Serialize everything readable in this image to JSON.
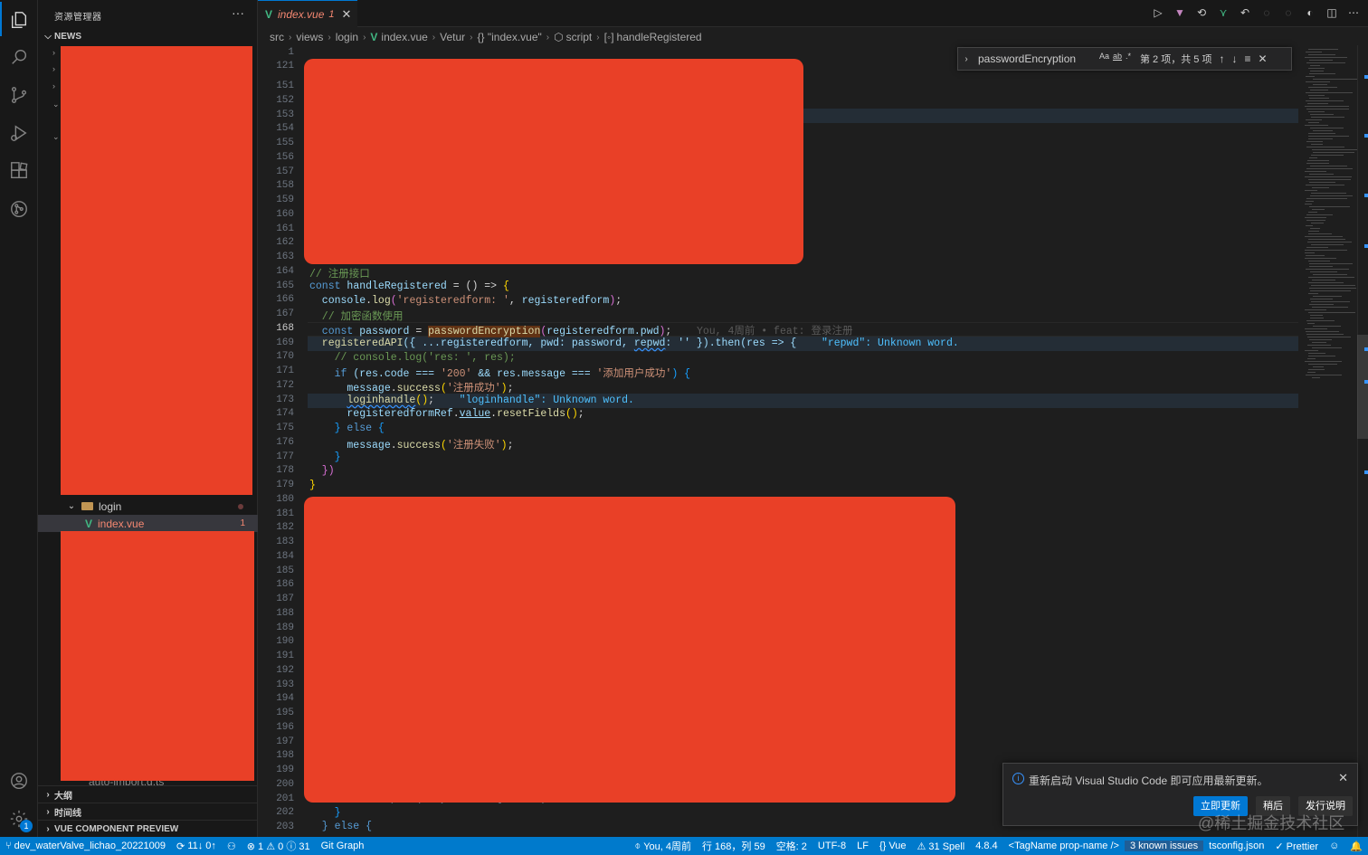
{
  "sidebar": {
    "title": "资源管理器",
    "more": "···",
    "section_news": "NEWS",
    "folder_login": "login",
    "file_index": "index.vue",
    "file_index_errors": "1",
    "partial_item": "auto-import.d.ts",
    "section_outline": "大纲",
    "section_timeline": "时间线",
    "section_vue_preview": "VUE COMPONENT PREVIEW"
  },
  "tab": {
    "label": "index.vue",
    "errors": "1",
    "close": "✕"
  },
  "breadcrumb": [
    "src",
    "views",
    "login",
    "index.vue",
    "Vetur",
    "{} \"index.vue\"",
    "script",
    "handleRegistered"
  ],
  "find": {
    "query": "passwordEncryption",
    "opt_case": "Aa",
    "opt_word": "ab",
    "opt_regex": ".*",
    "count": "第 2 项，共 5 项",
    "prev": "↑",
    "next": "↓",
    "selection": "≡",
    "close": "✕"
  },
  "editor": {
    "line_numbers_top": [
      "1",
      "121",
      "151",
      "152",
      "153",
      "154",
      "155",
      "156",
      "157",
      "158",
      "159",
      "160",
      "161",
      "162",
      "163",
      "164",
      "165",
      "166",
      "167",
      "168",
      "169",
      "170",
      "171",
      "172",
      "173",
      "174",
      "175",
      "176",
      "177",
      "178",
      "179",
      "180",
      "181",
      "182",
      "183",
      "184",
      "185",
      "186",
      "187",
      "188",
      "189",
      "190",
      "191",
      "192",
      "193",
      "194",
      "195",
      "196",
      "197",
      "198",
      "199",
      "200",
      "201",
      "202",
      "203"
    ],
    "current_line": "168",
    "code": {
      "l164": "// 注册接口",
      "l165_kw": "const",
      "l165_name": " handleRegistered ",
      "l165_rest": "= () => ",
      "l165_brace": "{",
      "l166_obj": "  console",
      "l166_fn": "log",
      "l166_str": "'registeredform: '",
      "l166_arg": "registeredform",
      "l167": "  // 加密函数使用",
      "l168_kw": "  const",
      "l168_var": " password ",
      "l168_fn": "passwordEncryption",
      "l168_arg": "registeredform.pwd",
      "l168_blame": "You, 4周前 • feat: 登录注册",
      "l169_fn": "  registeredAPI",
      "l169_body": "({ ...registeredform, pwd: password, ",
      "l169_wavy": "repwd",
      "l169_tail": ": '' }).then(res => {",
      "l169_diag": "\"repwd\": Unknown word.",
      "l170": "    // console.log('res: ', res);",
      "l171_kw": "    if",
      "l171_body": " (res.code === ",
      "l171_str1": "'200'",
      "l171_mid": " && res.message === ",
      "l171_str2": "'添加用户成功'",
      "l171_end": ") {",
      "l172_obj": "      message",
      "l172_fn": "success",
      "l172_str": "'注册成功'",
      "l173_fn": "loginhandle",
      "l173_diag": "\"loginhandle\": Unknown word.",
      "l174_obj": "      registeredformRef",
      "l174_val": "value",
      "l174_fn": "resetFields",
      "l175_kw": "else",
      "l176_obj": "      message",
      "l176_fn": "success",
      "l176_str": "'注册失败'",
      "l177": "    }",
      "l178": "  })",
      "l179": "}",
      "l201": "      router.push('/systemManagement');",
      "l202": "    }",
      "l203": "  } else {"
    }
  },
  "notification": {
    "message": "重新启动 Visual Studio Code 即可应用最新更新。",
    "btn_update": "立即更新",
    "btn_later": "稍后",
    "btn_notes": "发行说明",
    "close": "✕"
  },
  "status": {
    "branch": "dev_waterValve_lichao_20221009",
    "sync": "11↓ 0↑",
    "problems": "⊗ 1 ⚠ 0 ⓘ 31",
    "git_graph": "Git Graph",
    "blame": "You, 4周前",
    "position": "行 168，列 59",
    "spaces": "空格: 2",
    "encoding": "UTF-8",
    "eol": "LF",
    "language": "Vue",
    "spell": "⚠ 31 Spell",
    "version": "4.8.4",
    "tagname": "<TagName prop-name />",
    "issues": "3 known issues",
    "tsconfig": "tsconfig.json",
    "prettier": "✓ Prettier",
    "badge": "1"
  },
  "watermark": "@稀土掘金技术社区",
  "colors": {
    "redaction": "#e94027",
    "accent": "#007acc",
    "vue_green": "#41b883"
  }
}
